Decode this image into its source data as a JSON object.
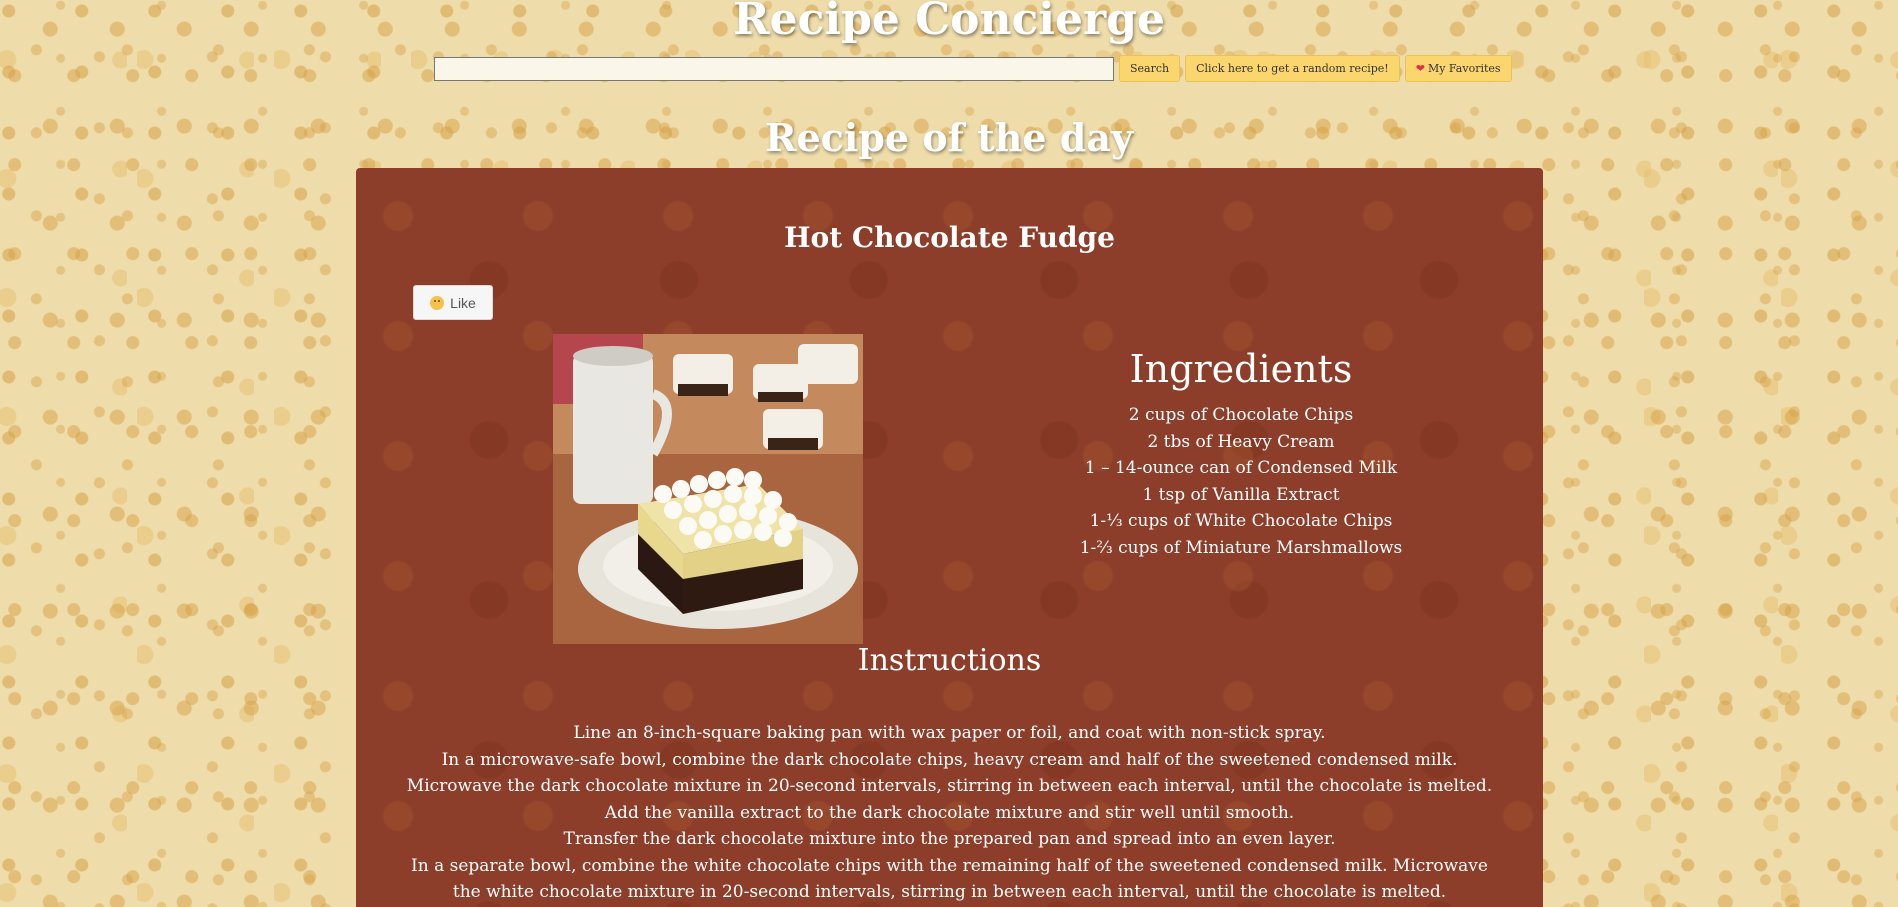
{
  "header": {
    "title": "Recipe Concierge",
    "search_placeholder": "",
    "search_value": "",
    "search_label": "Search",
    "random_label": "Click here to get a random recipe!",
    "favorites_label": "My Favorites"
  },
  "section_title": "Recipe of the day",
  "recipe": {
    "name": "Hot Chocolate Fudge",
    "like_label": "Like",
    "ingredients_title": "Ingredients",
    "ingredients": [
      "2 cups of Chocolate Chips",
      "2 tbs of Heavy Cream",
      "1 – 14-ounce can of Condensed Milk",
      "1 tsp of Vanilla Extract",
      "1-⅓ cups of White Chocolate Chips",
      "1-⅔ cups of Miniature Marshmallows"
    ],
    "instructions_title": "Instructions",
    "instructions": [
      "Line an 8-inch-square baking pan with wax paper or foil, and coat with non-stick spray.",
      "In a microwave-safe bowl, combine the dark chocolate chips, heavy cream and half of the sweetened condensed milk. Microwave the dark chocolate mixture in 20-second intervals, stirring in between each interval, until the chocolate is melted.",
      "Add the vanilla extract to the dark chocolate mixture and stir well until smooth.",
      "Transfer the dark chocolate mixture into the prepared pan and spread into an even layer.",
      "In a separate bowl, combine the white chocolate chips with the remaining half of the sweetened condensed milk. Microwave the white chocolate mixture in 20-second intervals, stirring in between each interval, until the chocolate is melted."
    ]
  },
  "icons": {
    "favorites": "heart-icon",
    "like": "smile-icon"
  }
}
